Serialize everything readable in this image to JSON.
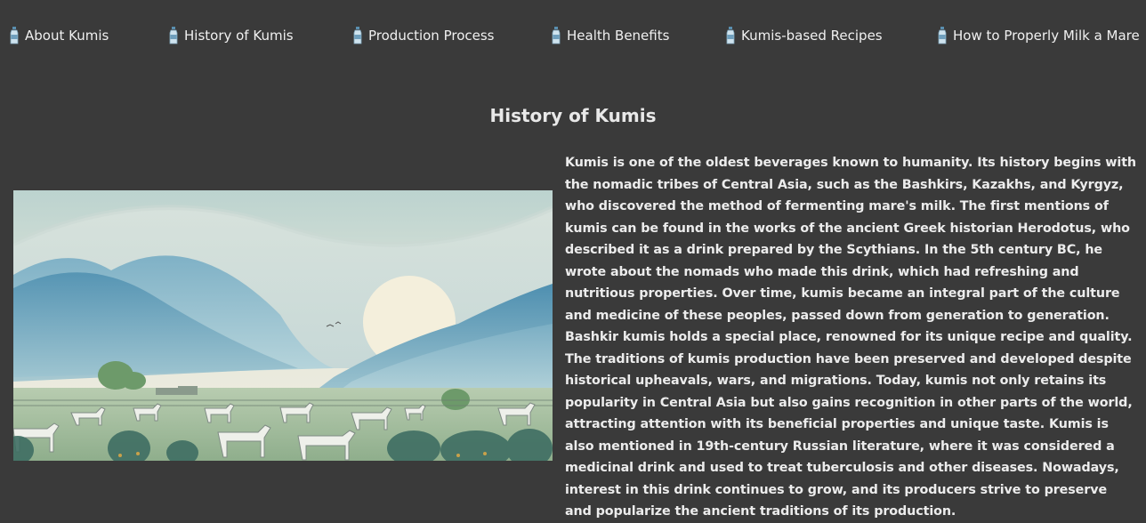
{
  "nav": {
    "items": [
      {
        "label": "About Kumis",
        "icon": "bottle-icon"
      },
      {
        "label": "History of Kumis",
        "icon": "bottle-icon"
      },
      {
        "label": "Production Process",
        "icon": "bottle-icon"
      },
      {
        "label": "Health Benefits",
        "icon": "bottle-icon"
      },
      {
        "label": "Kumis-based Recipes",
        "icon": "bottle-icon"
      },
      {
        "label": "How to Properly Milk a Mare",
        "icon": "bottle-icon"
      }
    ]
  },
  "page": {
    "title": "History of Kumis",
    "text": "Kumis is one of the oldest beverages known to humanity. Its history begins with the nomadic tribes of Central Asia, such as the Bashkirs, Kazakhs, and Kyrgyz, who discovered the method of fermenting mare's milk. The first mentions of kumis can be found in the works of the ancient Greek historian Herodotus, who described it as a drink prepared by the Scythians. In the 5th century BC, he wrote about the nomads who made this drink, which had refreshing and nutritious properties. Over time, kumis became an integral part of the culture and medicine of these peoples, passed down from generation to generation. Bashkir kumis holds a special place, renowned for its unique recipe and quality. The traditions of kumis production have been preserved and developed despite historical upheavals, wars, and migrations. Today, kumis not only retains its popularity in Central Asia but also gains recognition in other parts of the world, attracting attention with its beneficial properties and unique taste. Kumis is also mentioned in 19th-century Russian literature, where it was considered a medicinal drink and used to treat tuberculosis and other diseases. Nowadays, interest in this drink continues to grow, and its producers strive to preserve and popularize the ancient traditions of its production."
  },
  "colors": {
    "background": "#3a3a3a",
    "text": "#ececec"
  }
}
